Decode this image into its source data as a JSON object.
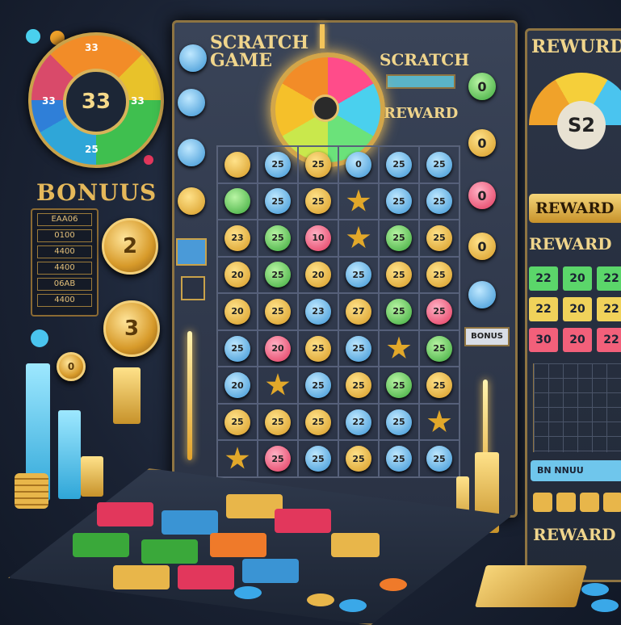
{
  "left_wheel": {
    "center_value": "33",
    "segments": [
      "33",
      "33",
      "25",
      "33"
    ]
  },
  "bonus_panel": {
    "title": "BONUUS",
    "rows": [
      "EAA06",
      "0100",
      "4400",
      "4400",
      "06AB",
      "4400"
    ],
    "coins": [
      "2",
      "3"
    ],
    "small_coin": "0"
  },
  "board": {
    "title_left_line1": "SCRATCH",
    "title_left_line2": "GAME",
    "title_right": "SCRATCH",
    "reward_label": "REWARD",
    "bonus_tag": "BONUS",
    "grid": [
      [
        [
          "gold",
          ""
        ],
        [
          "blue",
          "25"
        ],
        [
          "gold",
          "25"
        ],
        [
          "blue",
          "0"
        ],
        [
          "blue",
          "25"
        ],
        [
          "blue",
          "25"
        ]
      ],
      [
        [
          "green",
          ""
        ],
        [
          "blue",
          "25"
        ],
        [
          "gold",
          "25"
        ],
        [
          "star",
          ""
        ],
        [
          "blue",
          "25"
        ],
        [
          "blue",
          "25"
        ]
      ],
      [
        [
          "gold",
          "23"
        ],
        [
          "green",
          "25"
        ],
        [
          "pink",
          "10"
        ],
        [
          "star",
          ""
        ],
        [
          "green",
          "25"
        ],
        [
          "gold",
          "25"
        ]
      ],
      [
        [
          "gold",
          "20"
        ],
        [
          "green",
          "25"
        ],
        [
          "gold",
          "20"
        ],
        [
          "blue",
          "25"
        ],
        [
          "gold",
          "25"
        ],
        [
          "gold",
          "25"
        ]
      ],
      [
        [
          "gold",
          "20"
        ],
        [
          "gold",
          "25"
        ],
        [
          "blue",
          "23"
        ],
        [
          "gold",
          "27"
        ],
        [
          "green",
          "25"
        ],
        [
          "pink",
          "25"
        ]
      ],
      [
        [
          "blue",
          "25"
        ],
        [
          "pink",
          "20"
        ],
        [
          "gold",
          "25"
        ],
        [
          "blue",
          "25"
        ],
        [
          "star",
          ""
        ],
        [
          "green",
          "25"
        ]
      ],
      [
        [
          "blue",
          "20"
        ],
        [
          "star",
          ""
        ],
        [
          "blue",
          "25"
        ],
        [
          "gold",
          "25"
        ],
        [
          "green",
          "25"
        ],
        [
          "gold",
          "25"
        ]
      ],
      [
        [
          "gold",
          "25"
        ],
        [
          "gold",
          "25"
        ],
        [
          "gold",
          "25"
        ],
        [
          "blue",
          "22"
        ],
        [
          "blue",
          "25"
        ],
        [
          "star",
          ""
        ]
      ],
      [
        [
          "star",
          ""
        ],
        [
          "pink",
          "25"
        ],
        [
          "blue",
          "25"
        ],
        [
          "gold",
          "25"
        ],
        [
          "blue",
          "25"
        ],
        [
          "blue",
          "25"
        ]
      ]
    ],
    "right_tokens": [
      "0",
      "0",
      "0",
      "0",
      ""
    ]
  },
  "right_panel": {
    "title": "REWURD",
    "gauge_value": "S2",
    "reward_button": "REWARD",
    "reward_sub": "REWARD",
    "tiles": [
      [
        {
          "v": "22",
          "c": "#5bd66a"
        },
        {
          "v": "20",
          "c": "#5bd66a"
        },
        {
          "v": "22",
          "c": "#5bd66a"
        }
      ],
      [
        {
          "v": "22",
          "c": "#f0d25a"
        },
        {
          "v": "20",
          "c": "#f0d25a"
        },
        {
          "v": "22",
          "c": "#f0d25a"
        }
      ],
      [
        {
          "v": "30",
          "c": "#f2607a"
        },
        {
          "v": "20",
          "c": "#f2607a"
        },
        {
          "v": "22",
          "c": "#f2607a"
        }
      ]
    ],
    "bar_label": "BN NNUU",
    "bottom_label": "REWARD"
  },
  "colors": {
    "gold": "#d8b35a",
    "frame": "#8e7442",
    "background": "#1a2233"
  }
}
